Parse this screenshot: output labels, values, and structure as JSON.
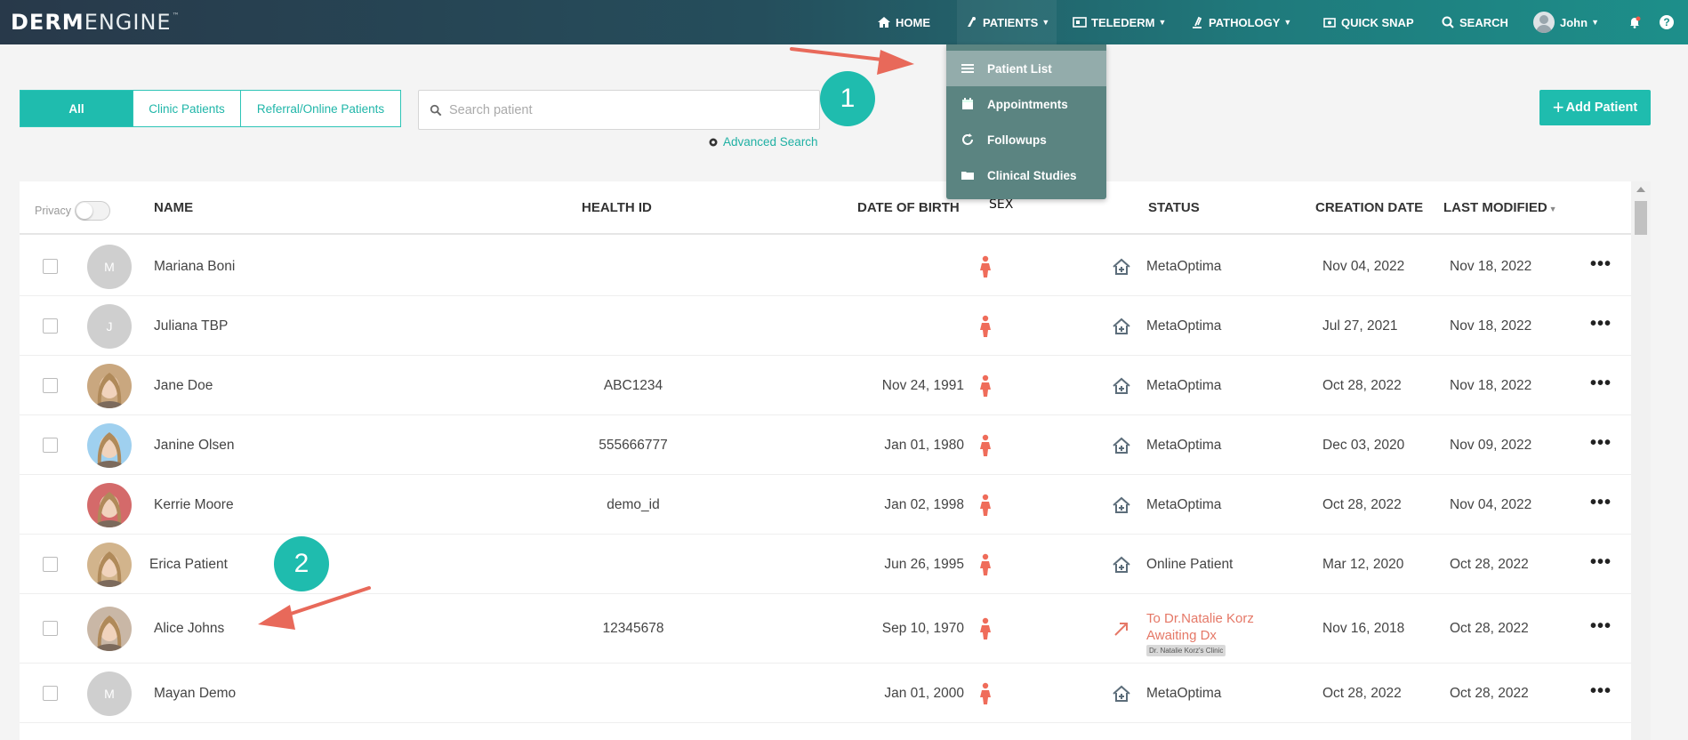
{
  "app": {
    "logo_bold": "DERM",
    "logo_light": "ENGINE",
    "logo_tm": "™"
  },
  "nav": {
    "home": "HOME",
    "patients": "PATIENTS",
    "telederm": "TELEDERM",
    "pathology": "PATHOLOGY",
    "quick_snap": "QUICK SNAP",
    "search": "SEARCH",
    "user": "John",
    "help": "?"
  },
  "patients_menu": {
    "items": [
      {
        "label": "Patient List",
        "icon": "list-icon"
      },
      {
        "label": "Appointments",
        "icon": "calendar-icon"
      },
      {
        "label": "Followups",
        "icon": "refresh-icon"
      },
      {
        "label": "Clinical Studies",
        "icon": "folder-icon"
      }
    ],
    "active": "Patient List"
  },
  "filters": {
    "tabs": [
      "All",
      "Clinic Patients",
      "Referral/Online Patients"
    ],
    "active": "All"
  },
  "search": {
    "placeholder": "Search patient",
    "value": "",
    "advanced": "Advanced Search"
  },
  "add_button": "Add Patient",
  "annotations": [
    "1",
    "2"
  ],
  "table": {
    "privacy_label": "Privacy",
    "columns": {
      "name": "NAME",
      "health_id": "HEALTH ID",
      "dob": "DATE OF BIRTH",
      "sex": "SEX",
      "status": "STATUS",
      "creation": "CREATION DATE",
      "modified": "LAST MODIFIED"
    },
    "rows": [
      {
        "initial": "M",
        "name": "Mariana Boni",
        "health_id": "",
        "dob": "",
        "status": "MetaOptima",
        "creation": "Nov 04, 2022",
        "modified": "Nov 18, 2022"
      },
      {
        "initial": "J",
        "name": "Juliana TBP",
        "health_id": "",
        "dob": "",
        "status": "MetaOptima",
        "creation": "Jul 27, 2021",
        "modified": "Nov 18, 2022"
      },
      {
        "initial": "",
        "name": "Jane Doe",
        "health_id": "ABC1234",
        "dob": "Nov 24, 1991",
        "status": "MetaOptima",
        "creation": "Oct 28, 2022",
        "modified": "Nov 18, 2022"
      },
      {
        "initial": "",
        "name": "Janine Olsen",
        "health_id": "555666777",
        "dob": "Jan 01, 1980",
        "status": "MetaOptima",
        "creation": "Dec 03, 2020",
        "modified": "Nov 09, 2022"
      },
      {
        "initial": "",
        "name": "Kerrie Moore",
        "health_id": "demo_id",
        "dob": "Jan 02, 1998",
        "status": "MetaOptima",
        "creation": "Oct 28, 2022",
        "modified": "Nov 04, 2022"
      },
      {
        "initial": "",
        "name": "Erica Patient",
        "health_id": "",
        "dob": "Jun 26, 1995",
        "status": "Online Patient",
        "creation": "Mar 12, 2020",
        "modified": "Oct 28, 2022"
      },
      {
        "initial": "",
        "name": "Alice Johns",
        "health_id": "12345678",
        "dob": "Sep 10, 1970",
        "status_line1": "To Dr.Natalie Korz",
        "status_line2": "Awaiting Dx",
        "status_tag": "Dr. Natalie Korz's Clinic",
        "creation": "Nov 16, 2018",
        "modified": "Oct 28, 2022"
      },
      {
        "initial": "M",
        "name": "Mayan Demo",
        "health_id": "",
        "dob": "Jan 01, 2000",
        "status": "MetaOptima",
        "creation": "Oct 28, 2022",
        "modified": "Oct 28, 2022"
      }
    ],
    "more_label": "•••"
  },
  "colors": {
    "accent": "#1fbcae",
    "sex_icon": "#ef6c5a",
    "arrow": "#e8695a"
  }
}
